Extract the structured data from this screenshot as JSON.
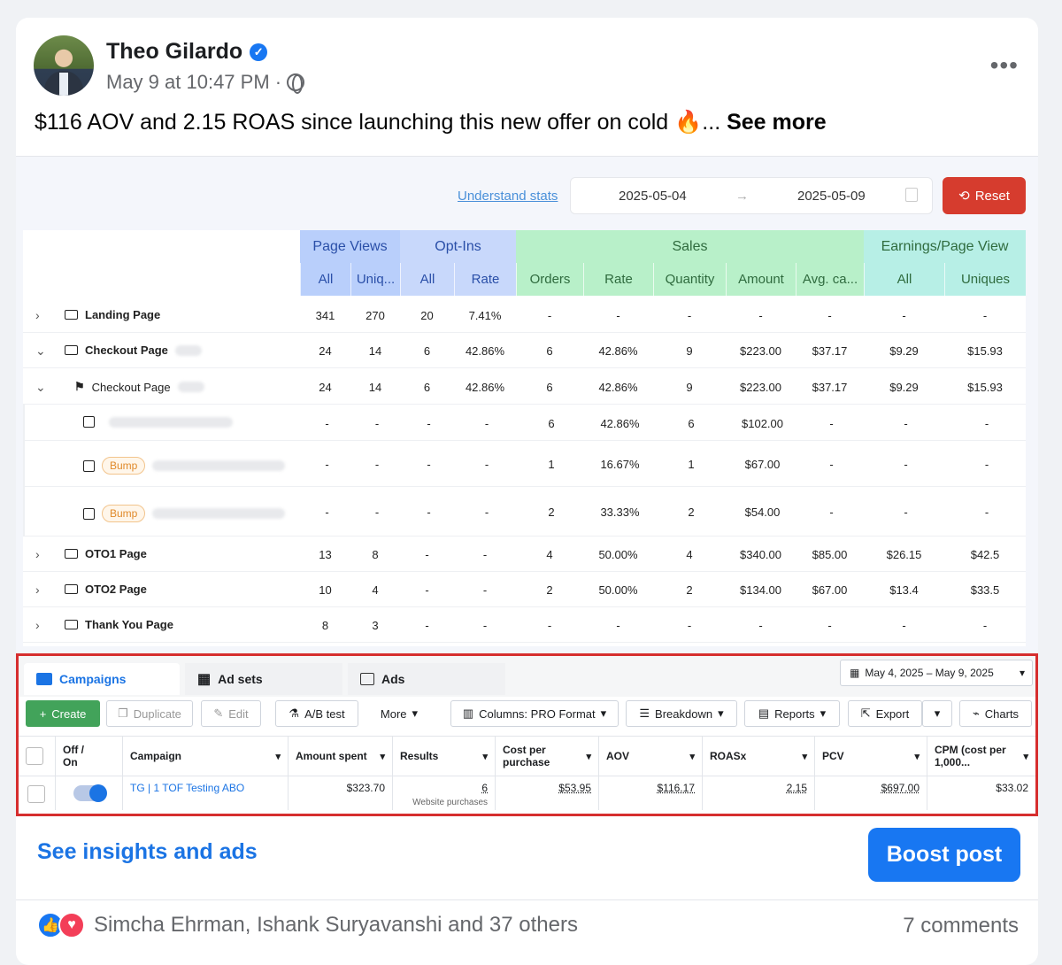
{
  "post": {
    "author": "Theo Gilardo",
    "timestamp": "May 9 at 10:47 PM ·",
    "text": "$116 AOV and 2.15 ROAS since launching this new offer on cold",
    "text_tail": "...",
    "see_more": "See more",
    "menu": "•••"
  },
  "stats": {
    "understand": "Understand stats",
    "date_from": "2025-05-04",
    "date_to": "2025-05-09",
    "arrow": "→",
    "reset": "Reset",
    "groups": {
      "page_views": "Page Views",
      "opt_ins": "Opt-Ins",
      "sales": "Sales",
      "earnings": "Earnings/Page View"
    },
    "cols": [
      "All",
      "Uniq...",
      "All",
      "Rate",
      "Orders",
      "Rate",
      "Quantity",
      "Amount",
      "Avg. ca...",
      "All",
      "Uniques"
    ],
    "rows": [
      {
        "name": "Landing Page",
        "vals": [
          "341",
          "270",
          "20",
          "7.41%",
          "-",
          "-",
          "-",
          "-",
          "-",
          "-",
          "-"
        ]
      },
      {
        "name": "Checkout Page",
        "vals": [
          "24",
          "14",
          "6",
          "42.86%",
          "6",
          "42.86%",
          "9",
          "$223.00",
          "$37.17",
          "$9.29",
          "$15.93"
        ]
      },
      {
        "name": "Checkout Page",
        "vals": [
          "24",
          "14",
          "6",
          "42.86%",
          "6",
          "42.86%",
          "9",
          "$223.00",
          "$37.17",
          "$9.29",
          "$15.93"
        ]
      },
      {
        "name": "",
        "vals": [
          "-",
          "-",
          "-",
          "-",
          "6",
          "42.86%",
          "6",
          "$102.00",
          "-",
          "-",
          "-"
        ]
      },
      {
        "name": "Bump",
        "vals": [
          "-",
          "-",
          "-",
          "-",
          "1",
          "16.67%",
          "1",
          "$67.00",
          "-",
          "-",
          "-"
        ]
      },
      {
        "name": "Bump",
        "vals": [
          "-",
          "-",
          "-",
          "-",
          "2",
          "33.33%",
          "2",
          "$54.00",
          "-",
          "-",
          "-"
        ]
      },
      {
        "name": "OTO1 Page",
        "vals": [
          "13",
          "8",
          "-",
          "-",
          "4",
          "50.00%",
          "4",
          "$340.00",
          "$85.00",
          "$26.15",
          "$42.5"
        ]
      },
      {
        "name": "OTO2 Page",
        "vals": [
          "10",
          "4",
          "-",
          "-",
          "2",
          "50.00%",
          "2",
          "$134.00",
          "$67.00",
          "$13.4",
          "$33.5"
        ]
      },
      {
        "name": "Thank You Page",
        "vals": [
          "8",
          "3",
          "-",
          "-",
          "-",
          "-",
          "-",
          "-",
          "-",
          "-",
          "-"
        ]
      }
    ]
  },
  "ads": {
    "tabs": [
      "Campaigns",
      "Ad sets",
      "Ads"
    ],
    "date_range": "May 4, 2025 – May 9, 2025",
    "toolbar": {
      "create": "Create",
      "duplicate": "Duplicate",
      "edit": "Edit",
      "ab": "A/B test",
      "more": "More",
      "columns": "Columns: PRO Format",
      "breakdown": "Breakdown",
      "reports": "Reports",
      "export": "Export",
      "charts": "Charts"
    },
    "headers": {
      "off_on_1": "Off /",
      "off_on_2": "On",
      "campaign": "Campaign",
      "spent": "Amount spent",
      "results": "Results",
      "cpp1": "Cost per",
      "cpp2": "purchase",
      "aov": "AOV",
      "roas": "ROASx",
      "pcv": "PCV",
      "cpm1": "CPM (cost per",
      "cpm2": "1,000..."
    },
    "row": {
      "campaign": "TG | 1 TOF Testing ABO",
      "spent": "$323.70",
      "results": "6",
      "results_sub": "Website purchases",
      "cpp": "$53.95",
      "aov": "$116.17",
      "roas": "2.15",
      "pcv": "$697.00",
      "cpm": "$33.02"
    }
  },
  "footer": {
    "insights": "See insights and ads",
    "boost": "Boost post",
    "reactions": "Simcha Ehrman, Ishank Suryavanshi and 37 others",
    "comments": "7 comments"
  }
}
